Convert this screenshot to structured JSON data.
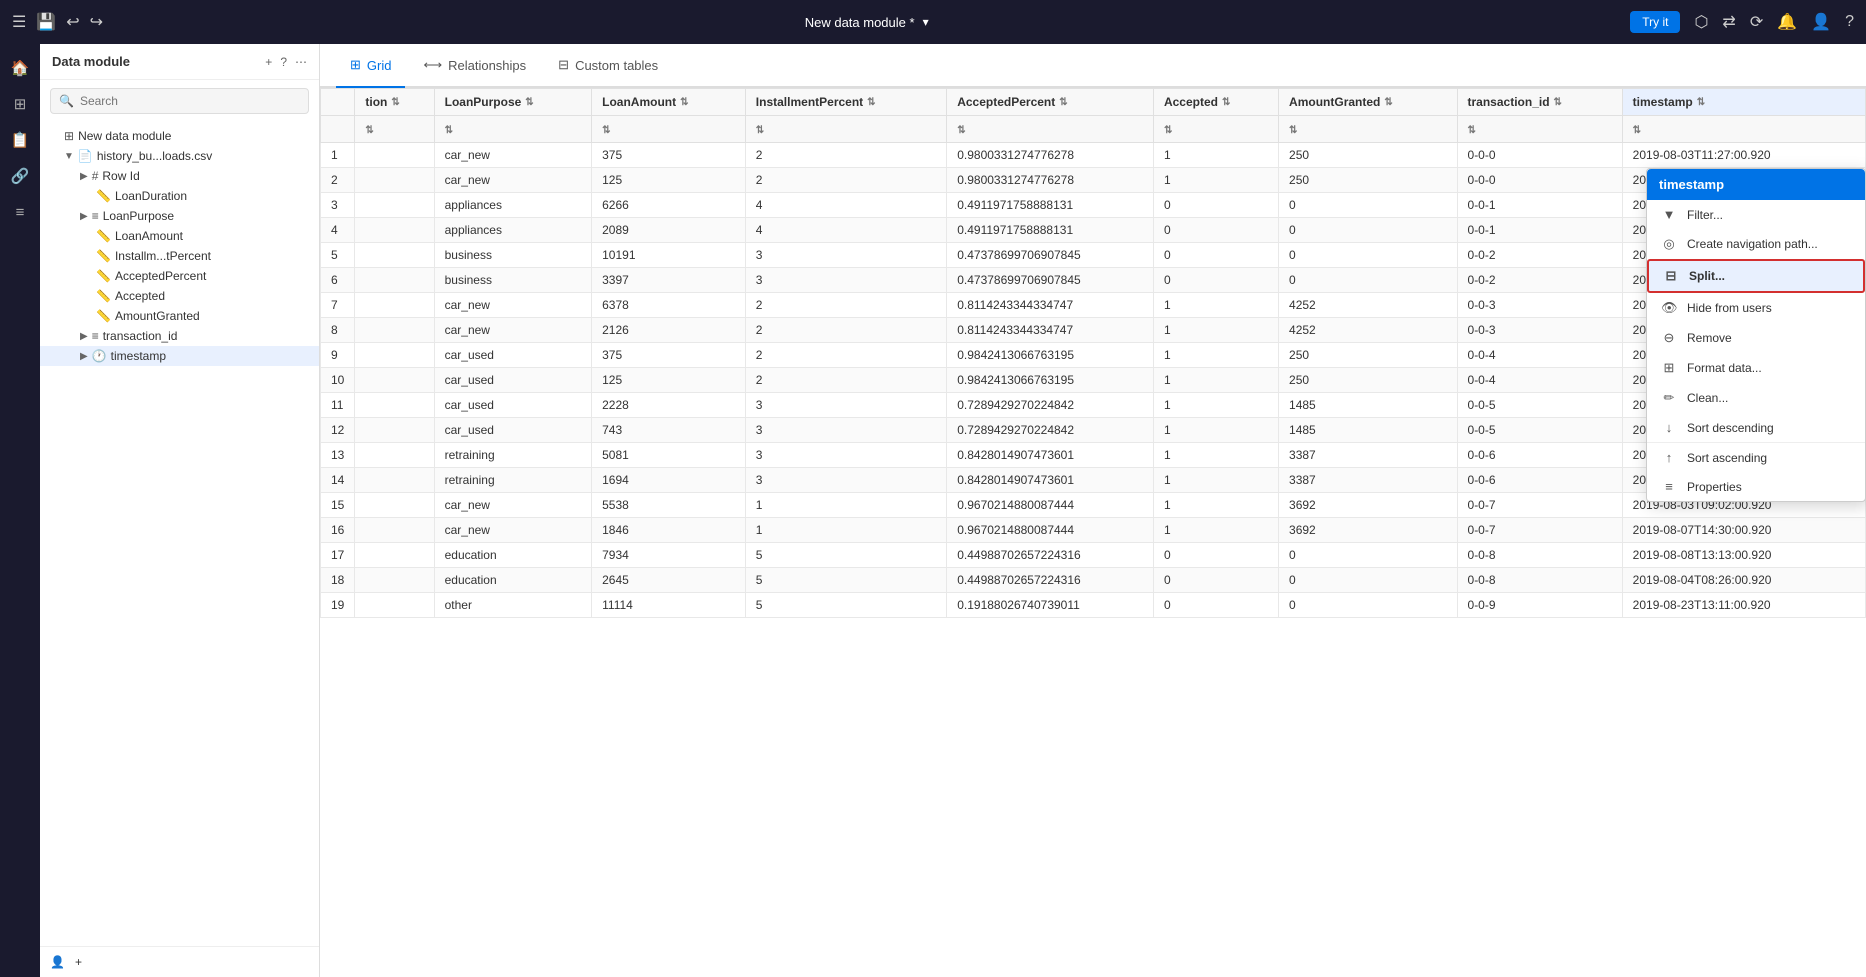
{
  "app": {
    "title": "New data module *",
    "try_it_label": "Try it"
  },
  "top_bar": {
    "left_icons": [
      "≡",
      "💾",
      "↩",
      "↪"
    ],
    "right_icons": [
      "⬡",
      "⇄",
      "⟳",
      "🔔",
      "👤",
      "?"
    ]
  },
  "sidebar": {
    "title": "Data module",
    "search_placeholder": "Search",
    "add_icon": "+",
    "help_icon": "?",
    "more_icon": "⋯",
    "tree": [
      {
        "level": 0,
        "icon": "🗂",
        "label": "New data module",
        "expandable": false,
        "type": "module"
      },
      {
        "level": 1,
        "icon": "📄",
        "label": "history_bu...loads.csv",
        "expandable": true,
        "expanded": true,
        "type": "file"
      },
      {
        "level": 2,
        "icon": "#",
        "label": "Row Id",
        "expandable": true,
        "type": "field"
      },
      {
        "level": 2,
        "icon": "📏",
        "label": "LoanDuration",
        "expandable": false,
        "type": "measure"
      },
      {
        "level": 2,
        "icon": "≡",
        "label": "LoanPurpose",
        "expandable": true,
        "type": "dimension"
      },
      {
        "level": 2,
        "icon": "📏",
        "label": "LoanAmount",
        "expandable": false,
        "type": "measure"
      },
      {
        "level": 2,
        "icon": "📏",
        "label": "Installm...tPercent",
        "expandable": false,
        "type": "measure"
      },
      {
        "level": 2,
        "icon": "📏",
        "label": "AcceptedPercent",
        "expandable": false,
        "type": "measure"
      },
      {
        "level": 2,
        "icon": "📏",
        "label": "Accepted",
        "expandable": false,
        "type": "measure"
      },
      {
        "level": 2,
        "icon": "📏",
        "label": "AmountGranted",
        "expandable": false,
        "type": "measure"
      },
      {
        "level": 2,
        "icon": "≡",
        "label": "transaction_id",
        "expandable": true,
        "type": "dimension"
      },
      {
        "level": 2,
        "icon": "🕐",
        "label": "timestamp",
        "expandable": true,
        "expanded": true,
        "active": true,
        "type": "time"
      }
    ]
  },
  "tabs": [
    {
      "label": "Grid",
      "icon": "⊞",
      "active": true
    },
    {
      "label": "Relationships",
      "icon": "⟷",
      "active": false
    },
    {
      "label": "Custom tables",
      "icon": "⊟",
      "active": false
    }
  ],
  "table": {
    "columns": [
      "",
      "tion",
      "LoanPurpose",
      "LoanAmount",
      "InstallmentPercent",
      "AcceptedPercent",
      "Accepted",
      "AmountGranted",
      "transaction_id"
    ],
    "rows": [
      {
        "id": "",
        "loanpurpose": "car_new",
        "loanamount": "375",
        "installment": "2",
        "accepted_pct": "0.9800331274776278",
        "accepted": "1",
        "amount_granted": "250",
        "txn_id": "0-0-0",
        "timestamp": "2019-08-03T11:27:00.920"
      },
      {
        "id": "",
        "loanpurpose": "car_new",
        "loanamount": "125",
        "installment": "2",
        "accepted_pct": "0.9800331274776278",
        "accepted": "1",
        "amount_granted": "250",
        "txn_id": "0-0-0",
        "timestamp": "2019-08-06T11:57:00.920"
      },
      {
        "id": "",
        "loanpurpose": "appliances",
        "loanamount": "6266",
        "installment": "4",
        "accepted_pct": "0.4911971758888131",
        "accepted": "0",
        "amount_granted": "0",
        "txn_id": "0-0-1",
        "timestamp": "2019-08-22T13:37:00.920"
      },
      {
        "id": "",
        "loanpurpose": "appliances",
        "loanamount": "2089",
        "installment": "4",
        "accepted_pct": "0.4911971758888131",
        "accepted": "0",
        "amount_granted": "0",
        "txn_id": "0-0-1",
        "timestamp": "2019-08-11T14:50:00.920"
      },
      {
        "id": "",
        "loanpurpose": "business",
        "loanamount": "10191",
        "installment": "3",
        "accepted_pct": "0.47378699706907845",
        "accepted": "0",
        "amount_granted": "0",
        "txn_id": "0-0-2",
        "timestamp": "2019-08-09T13:05:00.920"
      },
      {
        "id": "",
        "loanpurpose": "business",
        "loanamount": "3397",
        "installment": "3",
        "accepted_pct": "0.47378699706907845",
        "accepted": "0",
        "amount_granted": "0",
        "txn_id": "0-0-2",
        "timestamp": "2019-08-20T14:04:00.920"
      },
      {
        "id": "",
        "loanpurpose": "car_new",
        "loanamount": "6378",
        "installment": "2",
        "accepted_pct": "0.8114243344334747",
        "accepted": "1",
        "amount_granted": "4252",
        "txn_id": "0-0-3",
        "timestamp": "2019-08-03T09:02:00.920"
      },
      {
        "id": "",
        "loanpurpose": "car_new",
        "loanamount": "2126",
        "installment": "2",
        "accepted_pct": "0.8114243344334747",
        "accepted": "1",
        "amount_granted": "4252",
        "txn_id": "0-0-3",
        "timestamp": "2019-08-07T14:30:00.920"
      },
      {
        "id": "",
        "loanpurpose": "car_used",
        "loanamount": "375",
        "installment": "2",
        "accepted_pct": "0.9842413066763195",
        "accepted": "1",
        "amount_granted": "250",
        "txn_id": "0-0-4",
        "timestamp": "2019-08-03T11:27:00.920"
      },
      {
        "id": "",
        "loanpurpose": "car_used",
        "loanamount": "125",
        "installment": "2",
        "accepted_pct": "0.9842413066763195",
        "accepted": "1",
        "amount_granted": "250",
        "txn_id": "0-0-4",
        "timestamp": "2019-08-06T11:57:00.920"
      },
      {
        "id": "",
        "loanpurpose": "car_used",
        "loanamount": "2228",
        "installment": "3",
        "accepted_pct": "0.7289429270224842",
        "accepted": "1",
        "amount_granted": "1485",
        "txn_id": "0-0-5",
        "timestamp": "2019-08-22T13:37:00.920"
      },
      {
        "id": "",
        "loanpurpose": "car_used",
        "loanamount": "743",
        "installment": "3",
        "accepted_pct": "0.7289429270224842",
        "accepted": "1",
        "amount_granted": "1485",
        "txn_id": "0-0-5",
        "timestamp": "2019-08-11T14:50:00.920"
      },
      {
        "id": "",
        "loanpurpose": "retraining",
        "loanamount": "5081",
        "installment": "3",
        "accepted_pct": "0.8428014907473601",
        "accepted": "1",
        "amount_granted": "3387",
        "txn_id": "0-0-6",
        "timestamp": "2019-08-09T13:05:00.920"
      },
      {
        "id": "",
        "loanpurpose": "retraining",
        "loanamount": "1694",
        "installment": "3",
        "accepted_pct": "0.8428014907473601",
        "accepted": "1",
        "amount_granted": "3387",
        "txn_id": "0-0-6",
        "timestamp": "2019-08-20T14:04:00.920"
      },
      {
        "id": "",
        "loanpurpose": "car_new",
        "loanamount": "5538",
        "installment": "1",
        "accepted_pct": "0.9670214880087444",
        "accepted": "1",
        "amount_granted": "3692",
        "txn_id": "0-0-7",
        "timestamp": "2019-08-03T09:02:00.920"
      },
      {
        "id": "",
        "loanpurpose": "car_new",
        "loanamount": "1846",
        "installment": "1",
        "accepted_pct": "0.9670214880087444",
        "accepted": "1",
        "amount_granted": "3692",
        "txn_id": "0-0-7",
        "timestamp": "2019-08-07T14:30:00.920"
      },
      {
        "id": "",
        "loanpurpose": "education",
        "loanamount": "7934",
        "installment": "5",
        "accepted_pct": "0.44988702657224316",
        "accepted": "0",
        "amount_granted": "0",
        "txn_id": "0-0-8",
        "timestamp": "2019-08-08T13:13:00.920"
      },
      {
        "id": "",
        "loanpurpose": "education",
        "loanamount": "2645",
        "installment": "5",
        "accepted_pct": "0.44988702657224316",
        "accepted": "0",
        "amount_granted": "0",
        "txn_id": "0-0-8",
        "timestamp": "2019-08-04T08:26:00.920"
      },
      {
        "id": "",
        "loanpurpose": "other",
        "loanamount": "11114",
        "installment": "5",
        "accepted_pct": "0.19188026740739011",
        "accepted": "0",
        "amount_granted": "0",
        "txn_id": "0-0-9",
        "timestamp": "2019-08-23T13:11:00.920"
      }
    ]
  },
  "context_menu": {
    "header": "timestamp",
    "items": [
      {
        "label": "Filter...",
        "icon": "▼",
        "type": "filter"
      },
      {
        "label": "Create navigation path...",
        "icon": "◎",
        "type": "nav"
      },
      {
        "label": "Split...",
        "icon": "⊟",
        "type": "split",
        "highlighted": true
      },
      {
        "label": "Hide from users",
        "icon": "👁",
        "type": "hide"
      },
      {
        "label": "Remove",
        "icon": "⊖",
        "type": "remove"
      },
      {
        "label": "Format data...",
        "icon": "⊞",
        "type": "format"
      },
      {
        "label": "Clean...",
        "icon": "✏",
        "type": "clean"
      },
      {
        "label": "Sort descending",
        "icon": "↓",
        "type": "sort-desc"
      },
      {
        "label": "Sort ascending",
        "icon": "↑",
        "type": "sort-asc"
      },
      {
        "label": "Properties",
        "icon": "≡",
        "type": "properties"
      }
    ]
  },
  "left_nav": {
    "icons": [
      "🏠",
      "📊",
      "⊞",
      "🔗",
      "≡"
    ]
  }
}
